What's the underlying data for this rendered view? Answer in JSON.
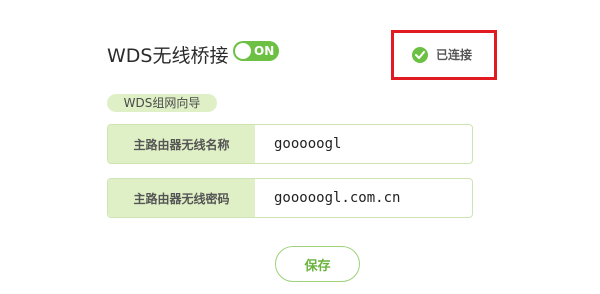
{
  "wds": {
    "title": "WDS无线桥接",
    "toggle_label": "ON"
  },
  "status": {
    "text": "已连接",
    "icon": "check-circle-icon"
  },
  "guide": {
    "label": "WDS组网向导"
  },
  "fields": [
    {
      "label": "主路由器无线名称",
      "value": "gooooogl"
    },
    {
      "label": "主路由器无线密码",
      "value": "gooooogl.com.cn"
    }
  ],
  "actions": {
    "save_label": "保存"
  },
  "colors": {
    "accent": "#6cc043",
    "label_bg": "#dff0c6",
    "highlight_border": "#e21b22"
  }
}
